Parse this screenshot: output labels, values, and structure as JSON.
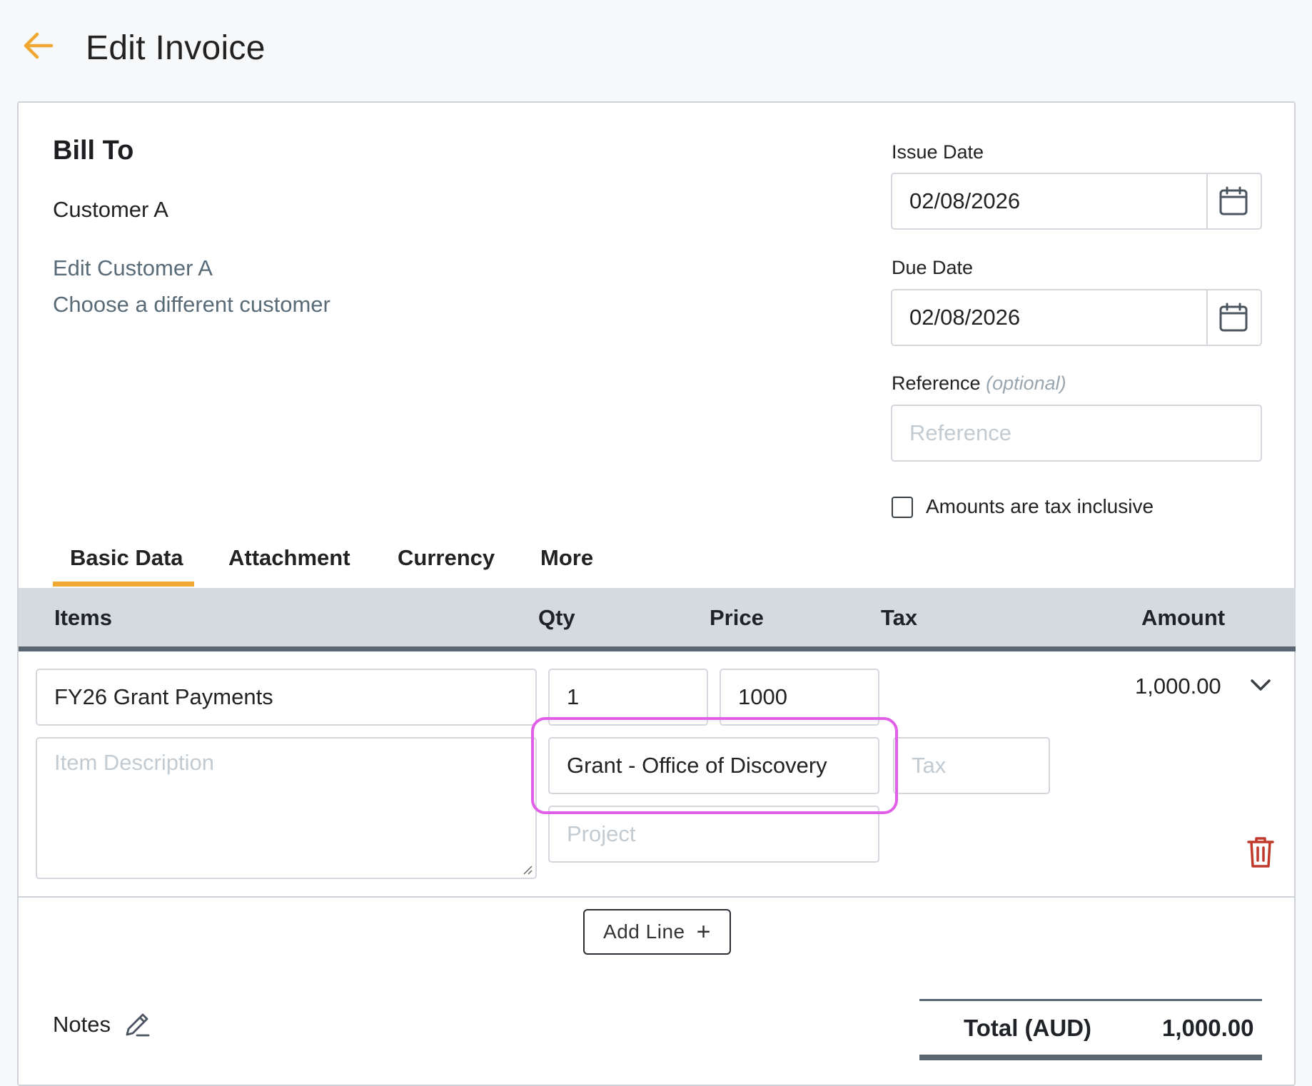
{
  "header": {
    "title": "Edit Invoice"
  },
  "bill_to": {
    "heading": "Bill To",
    "customer": "Customer A",
    "edit_link": "Edit Customer A",
    "choose_link": "Choose a different customer"
  },
  "issue_date": {
    "label": "Issue Date",
    "value": "02/08/2026"
  },
  "due_date": {
    "label": "Due Date",
    "value": "02/08/2026"
  },
  "reference": {
    "label": "Reference",
    "optional": "(optional)",
    "placeholder": "Reference",
    "value": ""
  },
  "tax_inclusive": {
    "label": "Amounts are tax inclusive",
    "checked": false
  },
  "tabs": [
    {
      "label": "Basic Data",
      "active": true
    },
    {
      "label": "Attachment",
      "active": false
    },
    {
      "label": "Currency",
      "active": false
    },
    {
      "label": "More",
      "active": false
    }
  ],
  "table": {
    "headers": {
      "items": "Items",
      "qty": "Qty",
      "price": "Price",
      "tax": "Tax",
      "amount": "Amount"
    },
    "line": {
      "item": "FY26 Grant Payments",
      "description_placeholder": "Item Description",
      "qty": "1",
      "price": "1000",
      "account": "Grant - Office of Discovery",
      "tax_placeholder": "Tax",
      "project_placeholder": "Project",
      "amount": "1,000.00"
    }
  },
  "add_line": {
    "label": "Add Line",
    "plus": "+"
  },
  "notes": {
    "label": "Notes"
  },
  "total": {
    "label": "Total (AUD)",
    "value": "1,000.00"
  },
  "colors": {
    "accent": "#f0a832",
    "highlight": "#e05ee8",
    "danger": "#c0392b",
    "link": "#5a6b78"
  }
}
